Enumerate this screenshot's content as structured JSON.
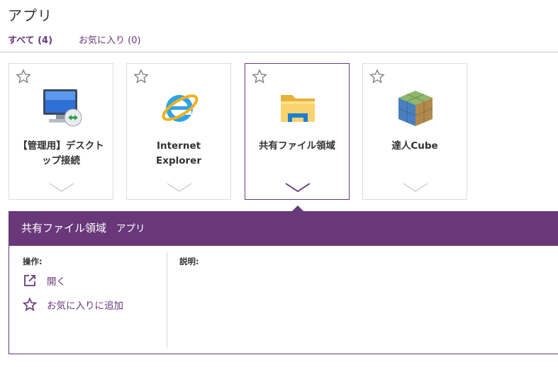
{
  "page": {
    "title": "アプリ"
  },
  "tabs": [
    {
      "label": "すべて (4)"
    },
    {
      "label": "お気に入り (0)"
    }
  ],
  "tiles": [
    {
      "label": "【管理用】デスクトップ接続",
      "icon": "remote-desktop-icon",
      "selected": false
    },
    {
      "label": "Internet Explorer",
      "icon": "internet-explorer-icon",
      "selected": false
    },
    {
      "label": "共有ファイル領域",
      "icon": "folder-icon",
      "selected": true
    },
    {
      "label": "達人Cube",
      "icon": "tatsuzin-cube-icon",
      "selected": false
    }
  ],
  "detail": {
    "title": "共有ファイル領域",
    "type": "アプリ",
    "actions_label": "操作:",
    "description_label": "説明:",
    "actions": [
      {
        "label": "開く",
        "icon": "open-external-icon"
      },
      {
        "label": "お気に入りに追加",
        "icon": "star-outline-icon"
      }
    ]
  },
  "colors": {
    "accent": "#68387a",
    "border": "#dcdcdc"
  }
}
